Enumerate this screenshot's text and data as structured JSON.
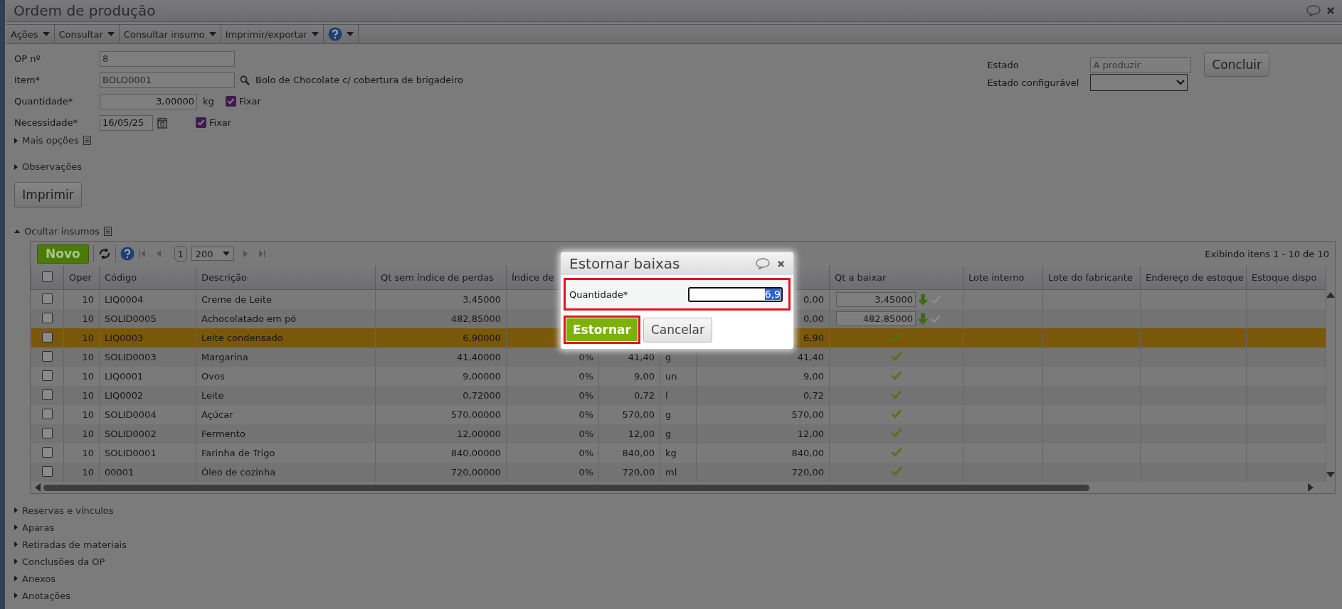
{
  "window": {
    "title": "Ordem de produção"
  },
  "menu": [
    {
      "label": "Ações"
    },
    {
      "label": "Consultar"
    },
    {
      "label": "Consultar insumo"
    },
    {
      "label": "Imprimir/exportar"
    },
    {
      "kind": "help"
    }
  ],
  "op": {
    "label": "OP nº",
    "value": "8"
  },
  "item": {
    "label": "Item*",
    "value": "BOLO0001",
    "description": "Bolo de Chocolate c/ cobertura de brigadeiro"
  },
  "quantidade": {
    "label": "Quantidade*",
    "value": "3,00000",
    "unit": "kg",
    "fix_label": "Fixar",
    "fixed": true
  },
  "necessidade": {
    "label": "Necessidade*",
    "value": "16/05/25",
    "fix_label": "Fixar",
    "fixed": true
  },
  "estado": {
    "label": "Estado",
    "value": "A produzir"
  },
  "estado_configuravel": {
    "label": "Estado configurável"
  },
  "concluir_button": "Concluir",
  "sections_top": [
    {
      "label": "Mais opções",
      "expanded": false,
      "kind": "with-icon"
    },
    {
      "label": "Observações",
      "expanded": false,
      "kind": "plain"
    }
  ],
  "print_button": "Imprimir",
  "insumos": {
    "label": "Ocultar insumos",
    "expanded": true,
    "new_button": "Novo",
    "page": "1",
    "page_size": "200",
    "summary": "Exibindo itens 1 - 10 de 10",
    "header_checked": false,
    "columns": [
      "Oper",
      "Código",
      "Descrição",
      "Qt sem índice de perdas",
      "Índice de",
      null,
      null,
      null,
      "Qt a baixar",
      "Lote interno",
      "Lote do fabricante",
      "Endereço de estoque",
      "Estoque dispo"
    ],
    "rows": [
      {
        "checked": false,
        "selected": false,
        "cells": [
          "10",
          "LIQ0004",
          "Creme de Leite",
          "3,45000",
          null,
          null,
          null,
          "0,00"
        ],
        "baixa": {
          "kind": "input",
          "value": "3,45000"
        }
      },
      {
        "checked": false,
        "selected": false,
        "cells": [
          "10",
          "SOLID0005",
          "Achocolatado em pó",
          "482,85000",
          null,
          null,
          null,
          "0,00"
        ],
        "baixa": {
          "kind": "input",
          "value": "482,85000"
        }
      },
      {
        "checked": false,
        "selected": true,
        "cells": [
          "10",
          "LIQ0003",
          "Leite condensado",
          "6,90000",
          null,
          null,
          null,
          "6,90"
        ],
        "baixa": {
          "kind": "check"
        }
      },
      {
        "checked": false,
        "selected": false,
        "cells": [
          "10",
          "SOLID0003",
          "Margarina",
          "41,40000",
          "0%",
          "41,40",
          "g",
          "41,40"
        ],
        "baixa": {
          "kind": "check"
        }
      },
      {
        "checked": false,
        "selected": false,
        "cells": [
          "10",
          "LIQ0001",
          "Ovos",
          "9,00000",
          "0%",
          "9,00",
          "un",
          "9,00"
        ],
        "baixa": {
          "kind": "check"
        }
      },
      {
        "checked": false,
        "selected": false,
        "cells": [
          "10",
          "LIQ0002",
          "Leite",
          "0,72000",
          "0%",
          "0,72",
          "l",
          "0,72"
        ],
        "baixa": {
          "kind": "check"
        }
      },
      {
        "checked": false,
        "selected": false,
        "cells": [
          "10",
          "SOLID0004",
          "Açúcar",
          "570,00000",
          "0%",
          "570,00",
          "g",
          "570,00"
        ],
        "baixa": {
          "kind": "check"
        }
      },
      {
        "checked": false,
        "selected": false,
        "cells": [
          "10",
          "SOLID0002",
          "Fermento",
          "12,00000",
          "0%",
          "12,00",
          "g",
          "12,00"
        ],
        "baixa": {
          "kind": "check"
        }
      },
      {
        "checked": false,
        "selected": false,
        "cells": [
          "10",
          "SOLID0001",
          "Farinha de Trigo",
          "840,00000",
          "0%",
          "840,00",
          "kg",
          "840,00"
        ],
        "baixa": {
          "kind": "check"
        }
      },
      {
        "checked": false,
        "selected": false,
        "cells": [
          "10",
          "00001",
          "Óleo de cozinha",
          "720,00000",
          "0%",
          "720,00",
          "ml",
          "720,00"
        ],
        "baixa": {
          "kind": "check"
        }
      }
    ]
  },
  "sections_bottom": [
    {
      "label": "Reservas e vínculos",
      "expanded": false
    },
    {
      "label": "Aparas",
      "expanded": false
    },
    {
      "label": "Retiradas de materiais",
      "expanded": false
    },
    {
      "label": "Conclusões da OP",
      "expanded": false
    },
    {
      "label": "Anexos",
      "expanded": false
    },
    {
      "label": "Anotações",
      "expanded": false
    }
  ],
  "dialog": {
    "title": "Estornar baixas",
    "field_label": "Quantidade*",
    "value": "6,9",
    "confirm": "Estornar",
    "cancel": "Cancelar"
  }
}
